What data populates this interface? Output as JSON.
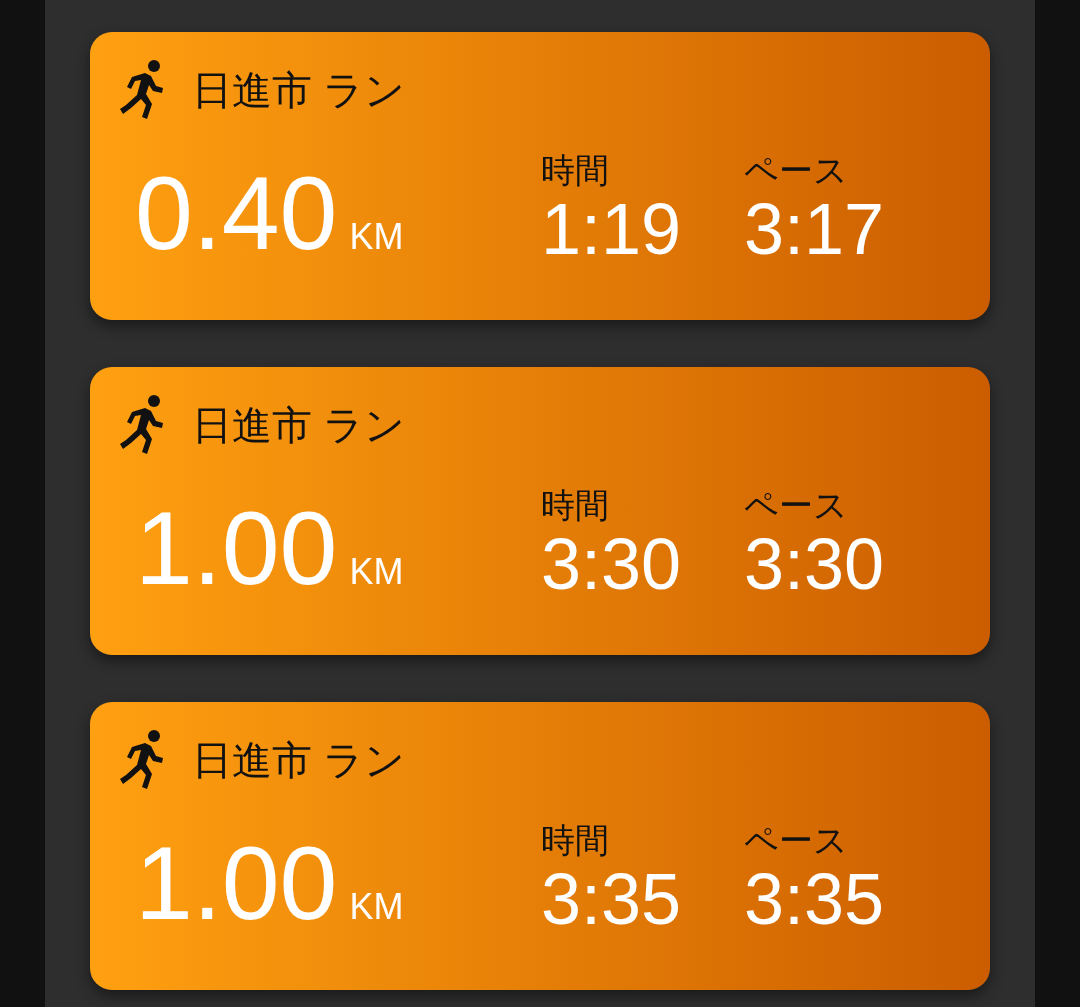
{
  "activities": [
    {
      "title": "日進市 ラン",
      "distance": "0.40",
      "unit": "KM",
      "time_label": "時間",
      "time": "1:19",
      "pace_label": "ペース",
      "pace": "3:17"
    },
    {
      "title": "日進市 ラン",
      "distance": "1.00",
      "unit": "KM",
      "time_label": "時間",
      "time": "3:30",
      "pace_label": "ペース",
      "pace": "3:30"
    },
    {
      "title": "日進市 ラン",
      "distance": "1.00",
      "unit": "KM",
      "time_label": "時間",
      "time": "3:35",
      "pace_label": "ペース",
      "pace": "3:35"
    }
  ]
}
